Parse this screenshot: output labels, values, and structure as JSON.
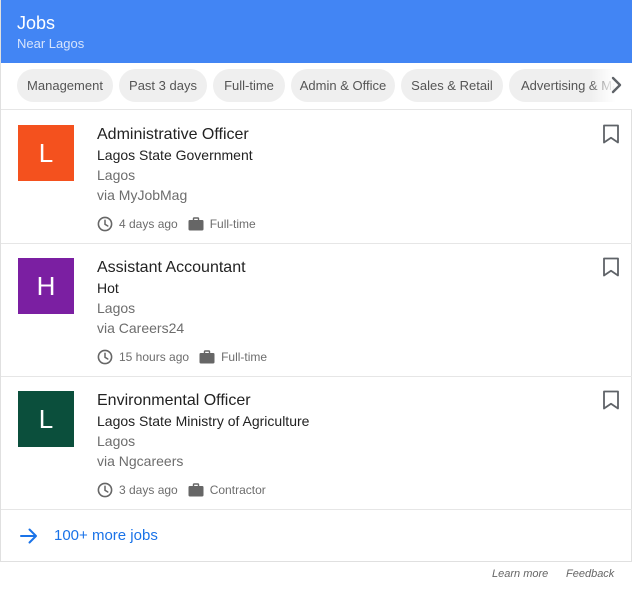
{
  "header": {
    "title": "Jobs",
    "subtitle": "Near Lagos",
    "background": "#4285f4"
  },
  "filters": {
    "chips": [
      "Management",
      "Past 3 days",
      "Full-time",
      "Admin & Office",
      "Sales & Retail",
      "Advertising & Marketing"
    ],
    "next_icon": "chevron-right-icon"
  },
  "jobs": [
    {
      "avatar_letter": "L",
      "avatar_color": "#f4511e",
      "title": "Administrative Officer",
      "company": "Lagos State Government",
      "location": "Lagos",
      "via": "via MyJobMag",
      "posted": "4 days ago",
      "type": "Full-time"
    },
    {
      "avatar_letter": "H",
      "avatar_color": "#7b1fa2",
      "title": "Assistant Accountant",
      "company": "Hot",
      "location": "Lagos",
      "via": "via Careers24",
      "posted": "15 hours ago",
      "type": "Full-time"
    },
    {
      "avatar_letter": "L",
      "avatar_color": "#0b4f3c",
      "title": "Environmental Officer",
      "company": "Lagos State Ministry of Agriculture",
      "location": "Lagos",
      "via": "via Ngcareers",
      "posted": "3 days ago",
      "type": "Contractor"
    }
  ],
  "more": {
    "label": "100+ more jobs",
    "color": "#1a73e8"
  },
  "footer": {
    "learn_more": "Learn more",
    "feedback": "Feedback"
  }
}
